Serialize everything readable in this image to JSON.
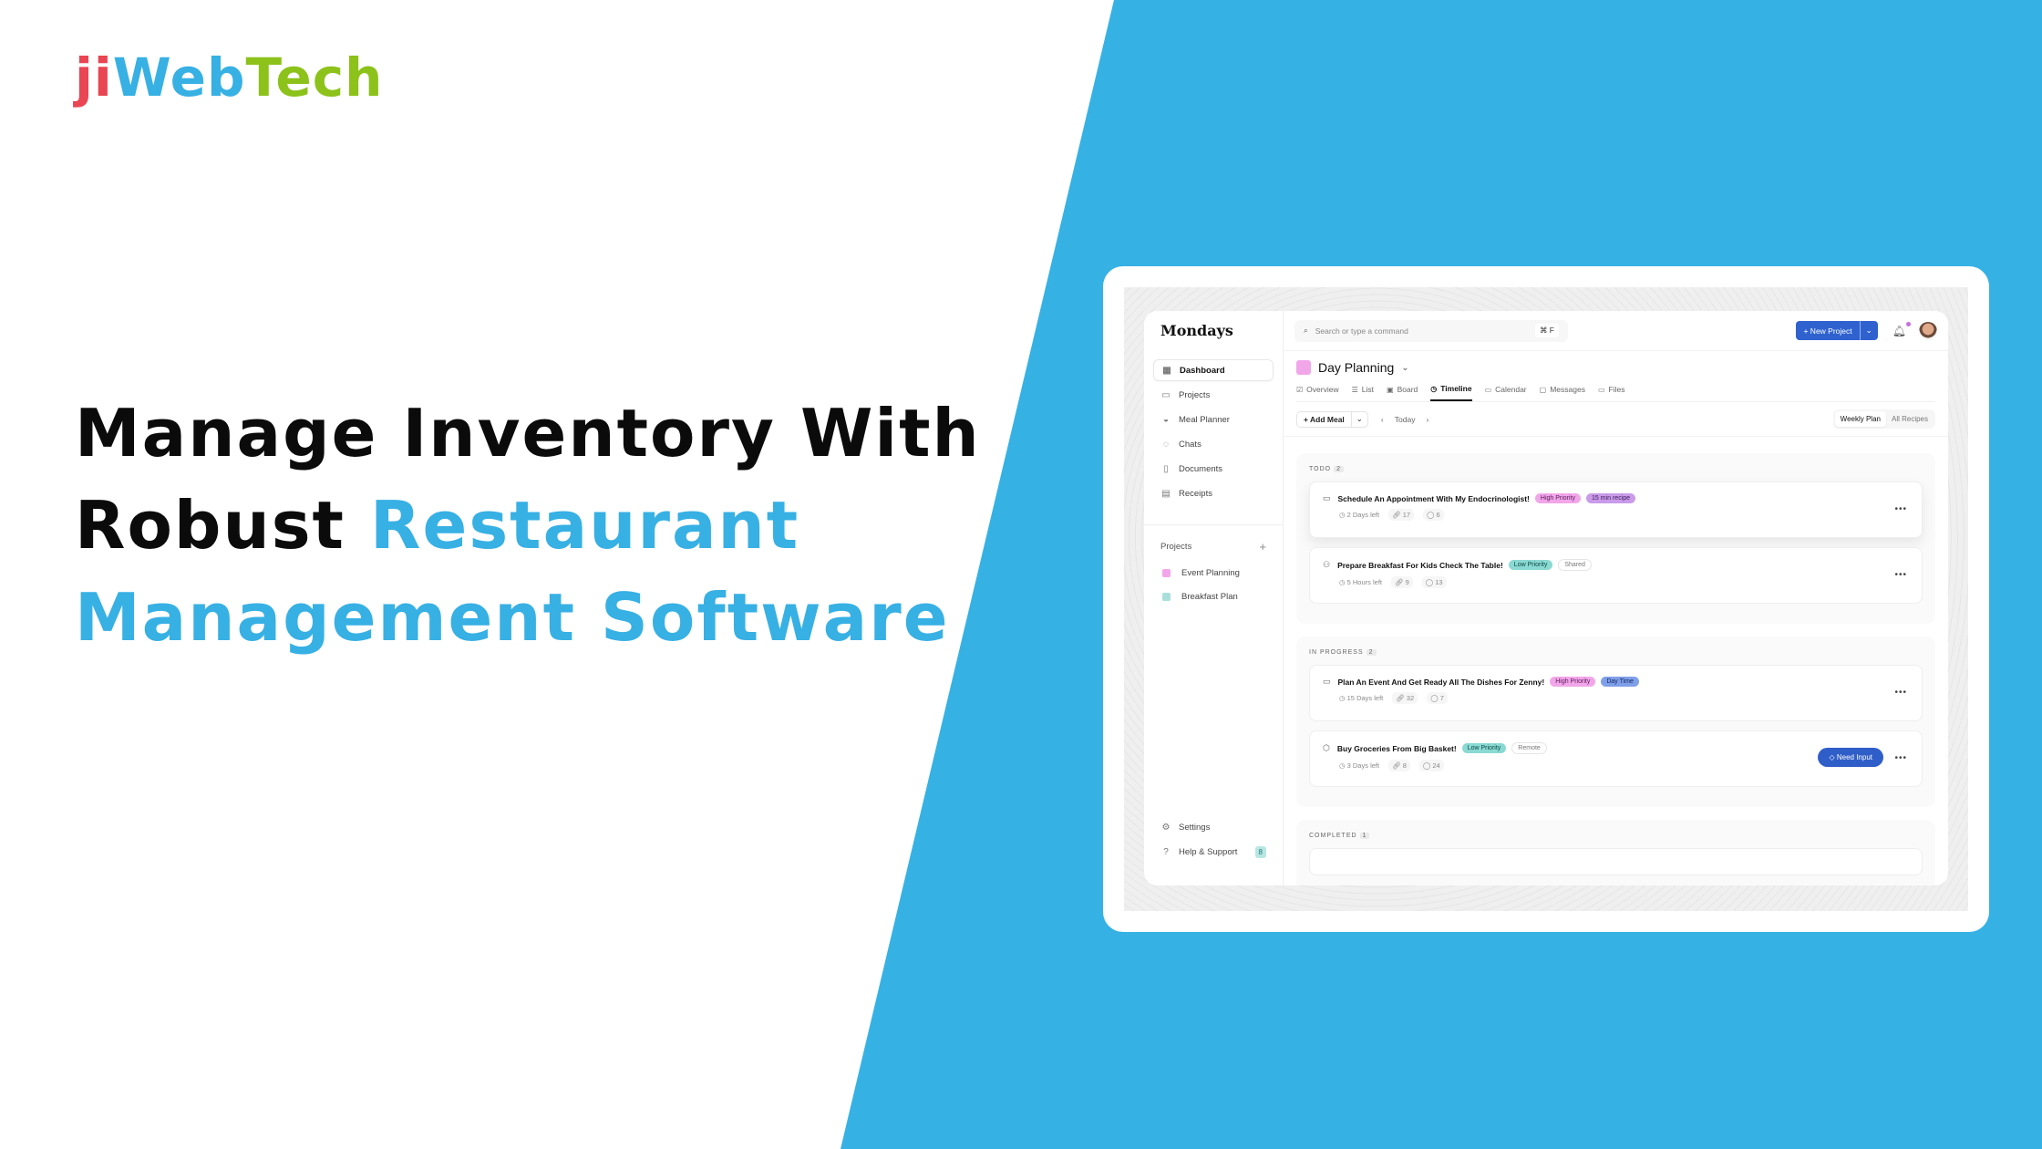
{
  "brand_logo": {
    "part1": "ji",
    "part2": "Web",
    "part3": "Tech"
  },
  "headline": {
    "line1": "Manage Inventory With",
    "line2_plain": "Robust ",
    "line2_accent": "Restaurant",
    "line3_accent": "Management Software"
  },
  "colors": {
    "background_blue": "#36b1e4",
    "accent_blue": "#37b0e4",
    "logo_red": "#e94552",
    "logo_green": "#8cc21a",
    "primary_button": "#2f62cf"
  },
  "app": {
    "name": "Mondays",
    "sidebar": {
      "items": [
        {
          "label": "Dashboard",
          "icon": "dashboard-icon",
          "active": true
        },
        {
          "label": "Projects",
          "icon": "calendar-icon"
        },
        {
          "label": "Meal Planner",
          "icon": "bowl-icon"
        },
        {
          "label": "Chats",
          "icon": "chat-icon"
        },
        {
          "label": "Documents",
          "icon": "document-icon"
        },
        {
          "label": "Receipts",
          "icon": "receipt-icon"
        }
      ],
      "projects_label": "Projects",
      "add_symbol": "+",
      "projects": [
        {
          "label": "Event Planning",
          "color": "#f2a6ea"
        },
        {
          "label": "Breakfast Plan",
          "color": "#a9dfdb"
        }
      ],
      "settings_label": "Settings",
      "help_label": "Help & Support",
      "help_badge": "8"
    },
    "topbar": {
      "search_placeholder": "Search or type a command",
      "search_shortcut": "⌘ F",
      "new_project_label": "+ New Project",
      "new_project_caret": "⌄"
    },
    "page": {
      "title": "Day Planning",
      "title_caret": "⌄",
      "tabs": [
        {
          "label": "Overview",
          "icon": "☑"
        },
        {
          "label": "List",
          "icon": "☰"
        },
        {
          "label": "Board",
          "icon": "▣"
        },
        {
          "label": "Timeline",
          "icon": "◷",
          "active": true
        },
        {
          "label": "Calendar",
          "icon": "▭"
        },
        {
          "label": "Messages",
          "icon": "▢"
        },
        {
          "label": "Files",
          "icon": "▭"
        }
      ]
    },
    "toolbar": {
      "add_meal_label": "+ Add Meal",
      "add_meal_caret": "⌄",
      "prev": "‹",
      "today_label": "Today",
      "next": "›",
      "view_weekly": "Weekly Plan",
      "view_all": "All Recipes"
    },
    "groups": [
      {
        "title": "TODO",
        "count": "2",
        "tasks": [
          {
            "title": "Schedule An Appointment With My Endocrinologist!",
            "icon": "▭",
            "tags": [
              {
                "label": "High Priority",
                "kind": "high"
              },
              {
                "label": "15 min recipe",
                "kind": "recipe"
              }
            ],
            "due": "2 Days left",
            "links": "17",
            "comments": "6"
          },
          {
            "title": "Prepare Breakfast For Kids Check The Table!",
            "icon": "⚇",
            "tags": [
              {
                "label": "Low Priority",
                "kind": "low"
              },
              {
                "label": "Shared",
                "kind": "outline"
              }
            ],
            "due": "5 Hours left",
            "links": "9",
            "comments": "13"
          }
        ]
      },
      {
        "title": "IN PROGRESS",
        "count": "2",
        "tasks": [
          {
            "title": "Plan An Event And Get Ready All The Dishes For Zenny!",
            "icon": "▭",
            "tags": [
              {
                "label": "High Priority",
                "kind": "high"
              },
              {
                "label": "Day Time",
                "kind": "day"
              }
            ],
            "due": "15 Days left",
            "links": "32",
            "comments": "7"
          },
          {
            "title": "Buy Groceries From Big Basket!",
            "icon": "⬡",
            "tags": [
              {
                "label": "Low Priority",
                "kind": "low"
              },
              {
                "label": "Remote",
                "kind": "outline"
              }
            ],
            "due": "3 Days left",
            "links": "8",
            "comments": "24",
            "action": "Need Input"
          }
        ]
      },
      {
        "title": "COMPLETED",
        "count": "1",
        "tasks": []
      }
    ],
    "more_symbol": "•••"
  }
}
